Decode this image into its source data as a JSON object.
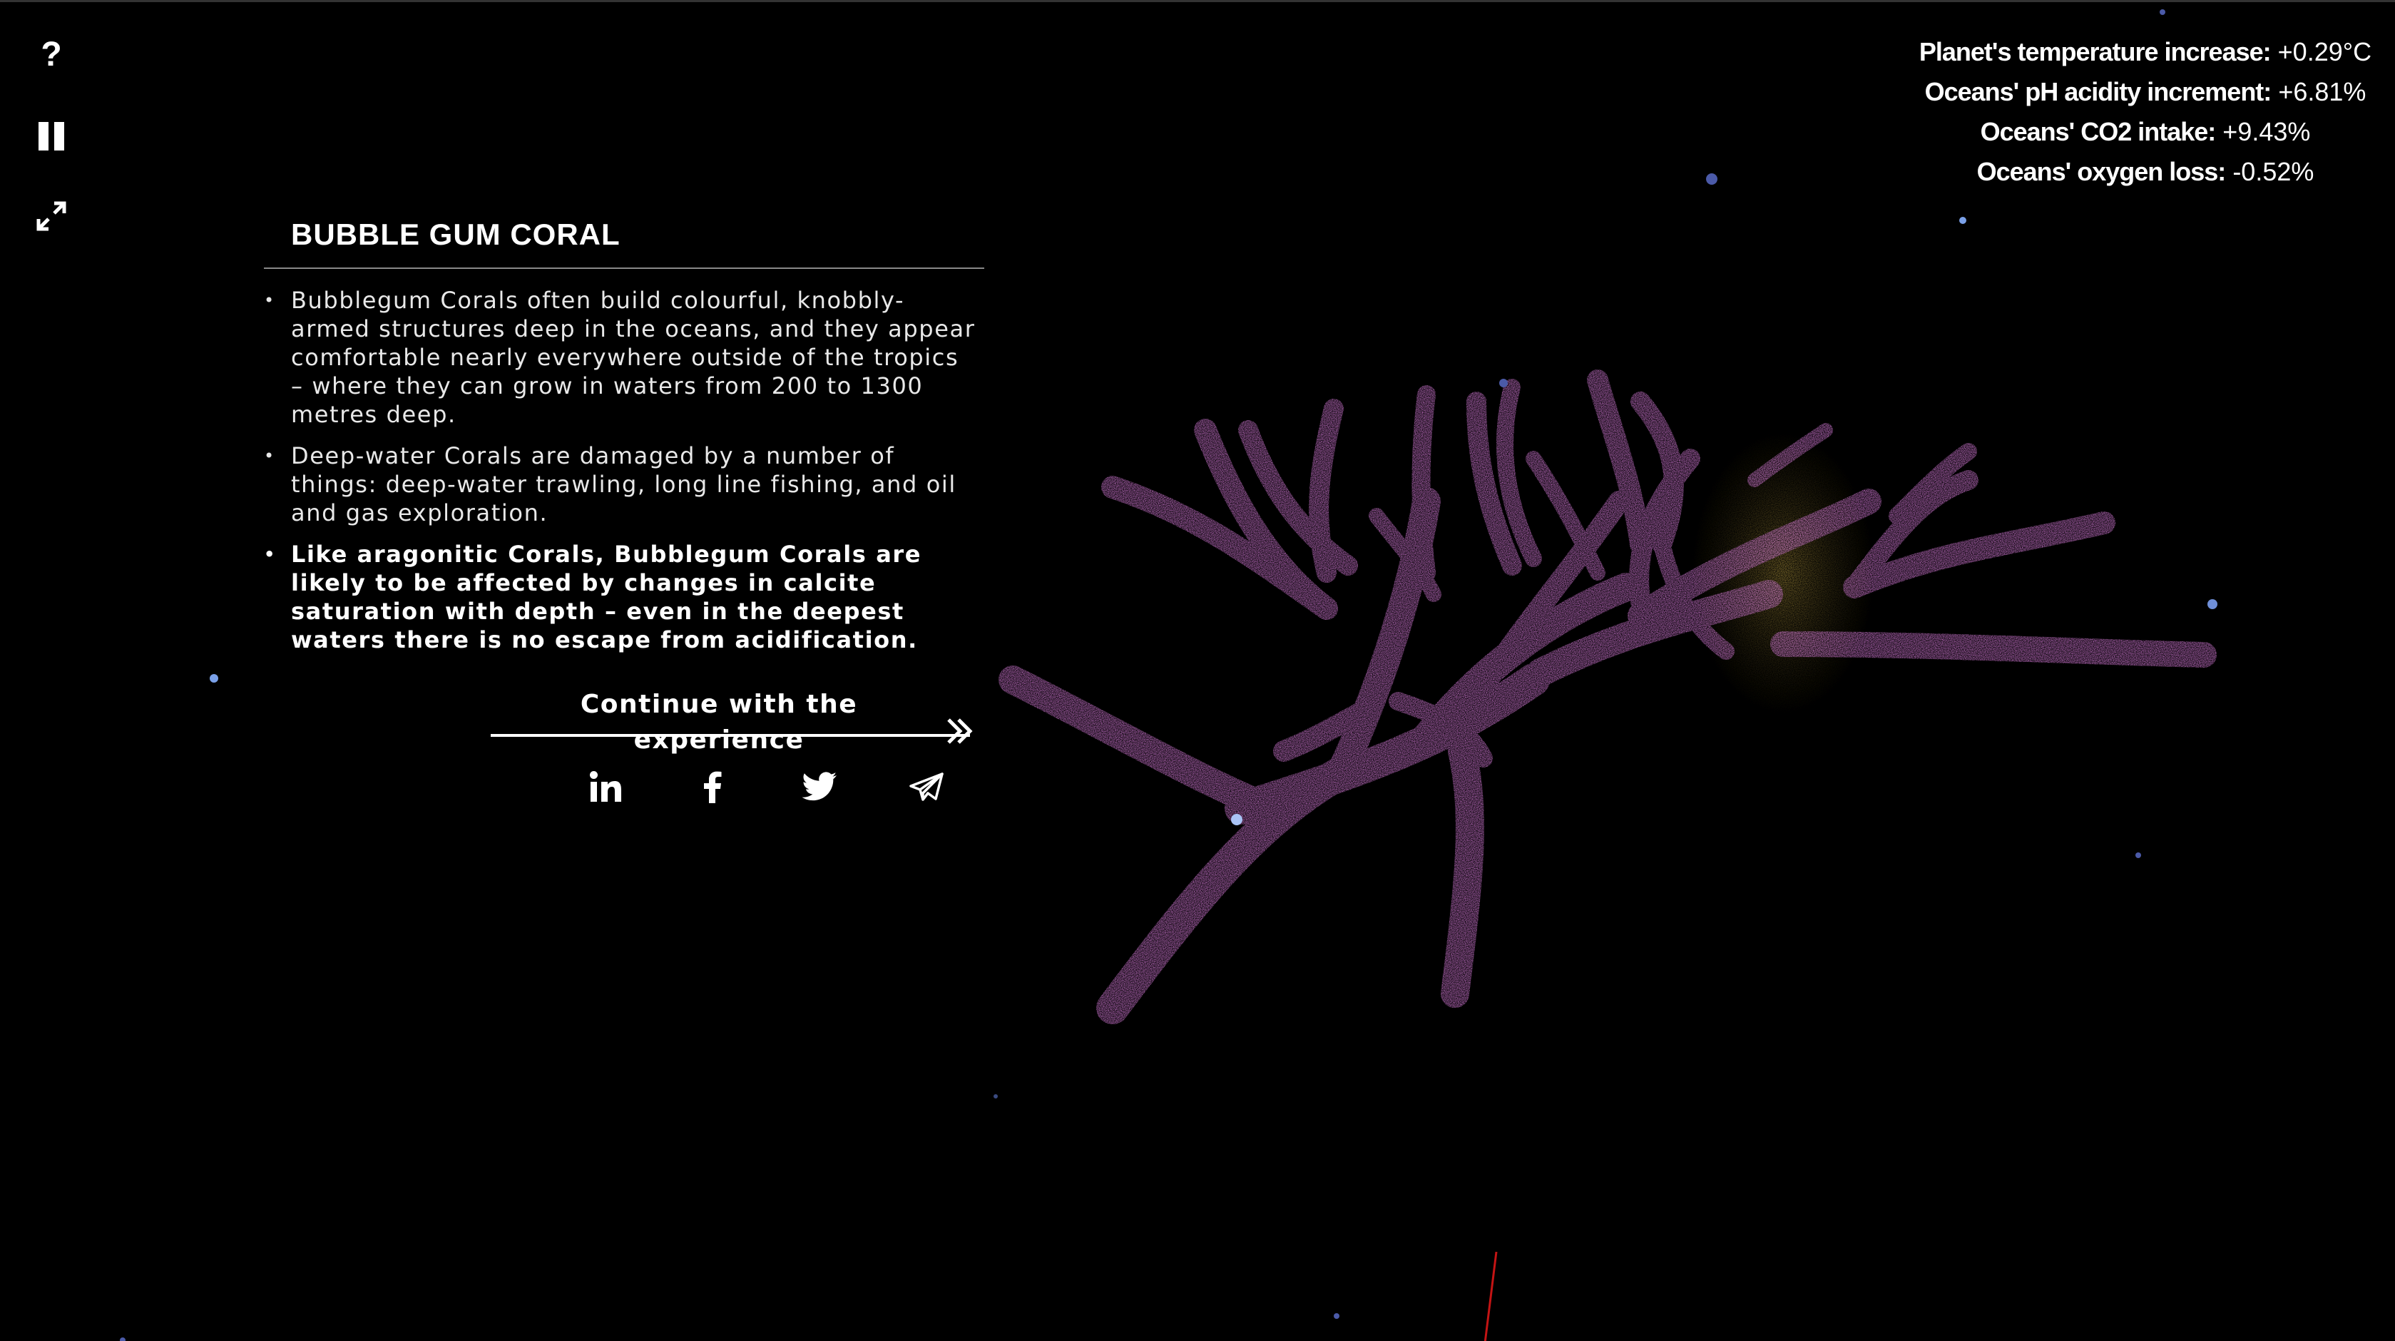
{
  "controls": {
    "help_symbol": "?"
  },
  "stats": [
    {
      "label": "Planet's temperature increase:",
      "value": "+0.29°C"
    },
    {
      "label": "Oceans' pH acidity increment:",
      "value": "+6.81%"
    },
    {
      "label": "Oceans' CO2 intake:",
      "value": "+9.43%"
    },
    {
      "label": "Oceans' oxygen loss:",
      "value": "-0.52%"
    }
  ],
  "panel": {
    "title": "BUBBLE GUM CORAL",
    "facts": [
      "Bubblegum Corals often build colourful, knobbly-armed structures deep in the oceans, and they appear comfortable nearly everywhere outside of the tropics – where they can grow in waters from 200 to 1300 metres deep.",
      "Deep-water Corals are damaged by a number of things: deep-water trawling, long line fishing, and oil and gas exploration.",
      "Like aragonitic Corals, Bubblegum Corals are likely to be affected by changes in calcite saturation with depth – even in the deepest waters there is no escape from acidification."
    ],
    "continue_label": "Continue with the experience"
  },
  "share": [
    {
      "name": "linkedin-icon"
    },
    {
      "name": "facebook-icon"
    },
    {
      "name": "twitter-icon"
    },
    {
      "name": "telegram-icon"
    }
  ],
  "colors": {
    "background": "#000000",
    "coral": "#d57ad8",
    "algae": "#a08a3a",
    "particle": "#6f8fd8"
  }
}
